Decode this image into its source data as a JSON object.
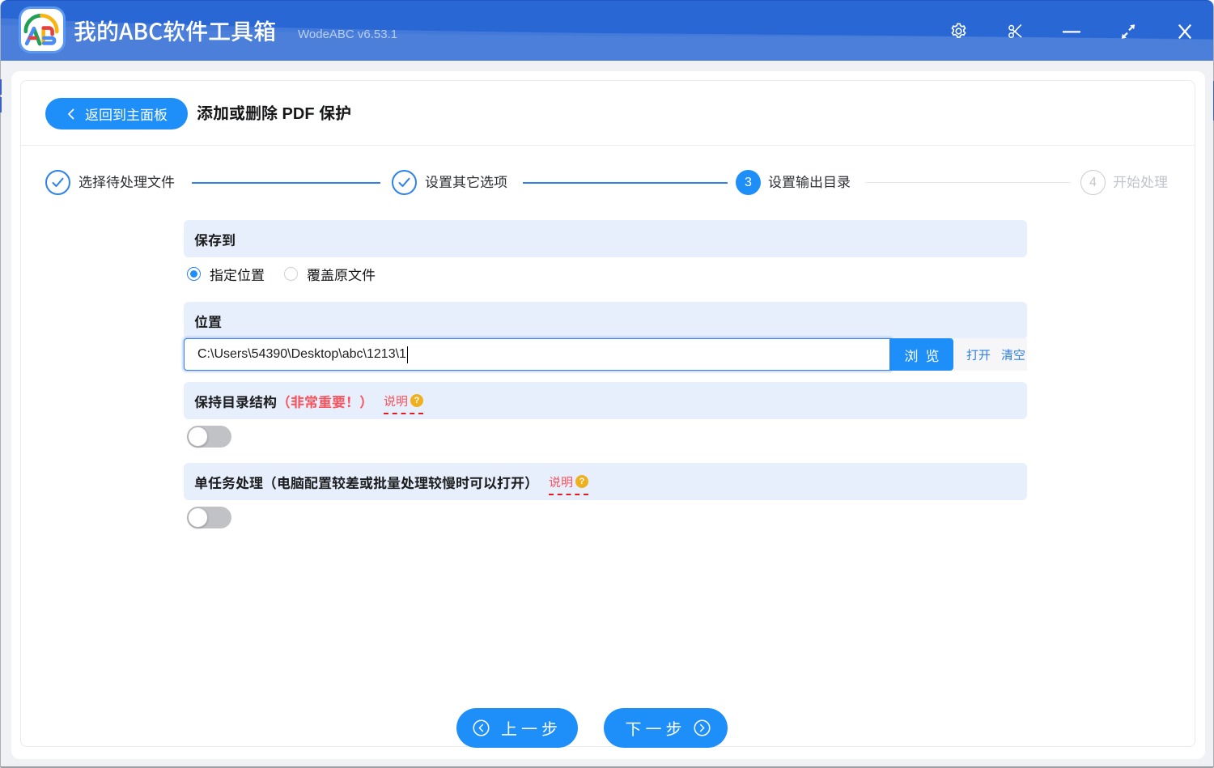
{
  "window": {
    "title": "我的ABC软件工具箱",
    "version": "WodeABC v6.53.1",
    "controls": [
      "settings",
      "screenshot",
      "minimize",
      "maximize",
      "close"
    ]
  },
  "page": {
    "back_label": "返回到主面板",
    "title": "添加或删除 PDF 保护"
  },
  "stepper": {
    "steps": [
      {
        "num": "1",
        "label": "选择待处理文件",
        "state": "done"
      },
      {
        "num": "2",
        "label": "设置其它选项",
        "state": "done"
      },
      {
        "num": "3",
        "label": "设置输出目录",
        "state": "active"
      },
      {
        "num": "4",
        "label": "开始处理",
        "state": "pending"
      }
    ]
  },
  "save_to": {
    "heading": "保存到",
    "options": [
      {
        "label": "指定位置",
        "selected": true
      },
      {
        "label": "覆盖原文件",
        "selected": false
      }
    ]
  },
  "location": {
    "heading": "位置",
    "path_value": "C:\\Users\\54390\\Desktop\\abc\\1213\\1",
    "focused": true,
    "browse_label": "浏览",
    "open_label": "打开",
    "clear_label": "清空"
  },
  "keep_structure": {
    "heading": "保持目录结构",
    "important_note": "（非常重要！）",
    "help_label": "说明",
    "help_badge": "?",
    "enabled": false
  },
  "single_task": {
    "heading": "单任务处理（电脑配置较差或批量处理较慢时可以打开）",
    "help_label": "说明",
    "help_badge": "?",
    "enabled": false
  },
  "footer": {
    "prev_label": "上一步",
    "next_label": "下一步"
  },
  "colors": {
    "header_blue": "#2867d4",
    "accent_blue": "#1e8ff9",
    "link_blue": "#2e7fe0",
    "band_blue": "#e8effc",
    "danger_red": "#f8545e",
    "badge_amber": "#eeb01e"
  }
}
